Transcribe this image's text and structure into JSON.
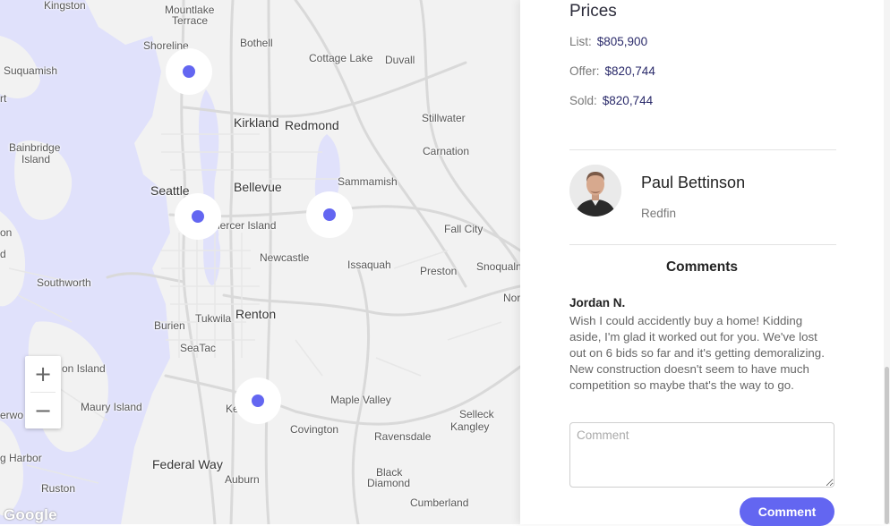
{
  "map": {
    "places": [
      {
        "id": "kingston",
        "text": "Kingston"
      },
      {
        "id": "mountlake1",
        "text": "Mountlake"
      },
      {
        "id": "mountlake2",
        "text": "Terrace"
      },
      {
        "id": "shoreline",
        "text": "Shoreline"
      },
      {
        "id": "bothell",
        "text": "Bothell"
      },
      {
        "id": "cottage-lake",
        "text": "Cottage Lake"
      },
      {
        "id": "duvall",
        "text": "Duvall"
      },
      {
        "id": "suquamish",
        "text": "Suquamish"
      },
      {
        "id": "kirkland",
        "text": "Kirkland"
      },
      {
        "id": "redmond",
        "text": "Redmond"
      },
      {
        "id": "stillwater",
        "text": "Stillwater"
      },
      {
        "id": "bainbridge1",
        "text": "Bainbridge"
      },
      {
        "id": "bainbridge2",
        "text": "Island"
      },
      {
        "id": "carnation",
        "text": "Carnation"
      },
      {
        "id": "seattle",
        "text": "Seattle"
      },
      {
        "id": "bellevue",
        "text": "Bellevue"
      },
      {
        "id": "sammamish",
        "text": "Sammamish"
      },
      {
        "id": "mercer",
        "text": "lercer Island"
      },
      {
        "id": "fall-city",
        "text": "Fall City"
      },
      {
        "id": "newcastle",
        "text": "Newcastle"
      },
      {
        "id": "issaquah",
        "text": "Issaquah"
      },
      {
        "id": "preston",
        "text": "Preston"
      },
      {
        "id": "snoqualmie",
        "text": "Snoqualn"
      },
      {
        "id": "southworth",
        "text": "Southworth"
      },
      {
        "id": "nor",
        "text": "Nor"
      },
      {
        "id": "tukwila",
        "text": "Tukwila"
      },
      {
        "id": "renton",
        "text": "Renton"
      },
      {
        "id": "burien",
        "text": "Burien"
      },
      {
        "id": "seatac",
        "text": "SeaTac"
      },
      {
        "id": "vashon",
        "text": "on Island"
      },
      {
        "id": "maury",
        "text": "Maury Island"
      },
      {
        "id": "kent",
        "text": "Ke"
      },
      {
        "id": "maple-valley",
        "text": "Maple Valley"
      },
      {
        "id": "erwo",
        "text": "erwo"
      },
      {
        "id": "selleck",
        "text": "Selleck"
      },
      {
        "id": "kangley",
        "text": "Kangley"
      },
      {
        "id": "covington",
        "text": "Covington"
      },
      {
        "id": "ravensdale",
        "text": "Ravensdale"
      },
      {
        "id": "harbor",
        "text": "g Harbor"
      },
      {
        "id": "federal-way",
        "text": "Federal Way"
      },
      {
        "id": "black-diamond1",
        "text": "Black"
      },
      {
        "id": "black-diamond2",
        "text": "Diamond"
      },
      {
        "id": "auburn",
        "text": "Auburn"
      },
      {
        "id": "ruston",
        "text": "Ruston"
      },
      {
        "id": "cumberland",
        "text": "Cumberland"
      },
      {
        "id": "edge-rt",
        "text": "rt"
      },
      {
        "id": "edge-on",
        "text": "on"
      },
      {
        "id": "edge-d",
        "text": "d"
      }
    ],
    "zoom_in_label": "+",
    "zoom_out_label": "−",
    "attribution": "Google",
    "marker_color": "#6366f1",
    "water_color": "#e0e1fb"
  },
  "prices": {
    "title": "Prices",
    "list_label": "List:",
    "list_value": "$805,900",
    "offer_label": "Offer:",
    "offer_value": "$820,744",
    "sold_label": "Sold:",
    "sold_value": "$820,744"
  },
  "agent": {
    "name": "Paul Bettinson",
    "company": "Redfin"
  },
  "comments": {
    "heading": "Comments",
    "items": [
      {
        "author": "Jordan N.",
        "text": "Wish I could accidently buy a home! Kidding aside, I'm glad it worked out for you. We've lost out on 6 bids so far and it's getting demoralizing. New construction doesn't seem to have much competition so maybe that's the way to go."
      }
    ],
    "input_placeholder": "Comment",
    "submit_label": "Comment",
    "accent_color": "#6366f1"
  }
}
